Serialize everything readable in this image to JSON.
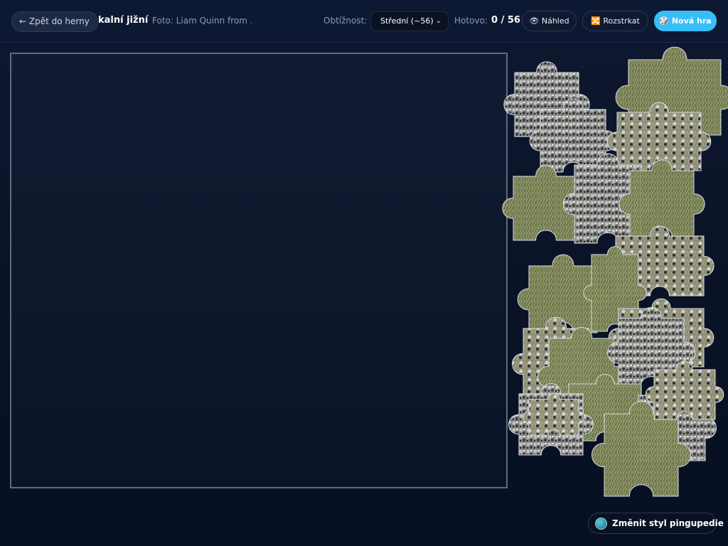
{
  "header": {
    "back_label": "← Zpět do herny",
    "title": "kalní jižní",
    "credit": "Foto: Liam Quinn from ...",
    "difficulty_label": "Obtížnost:",
    "difficulty_value": "Střední (~56)",
    "done_label": "Hotovo:",
    "done_value": "0 / 56",
    "preview_label": "👁 Náhled",
    "shuffle_label": "🔀 Rozstrkat",
    "new_game_label": "🎲 Nová hra"
  },
  "puzzle": {
    "placed": 0,
    "total": 56
  },
  "footer": {
    "style_label": "Změnit styl pingupedie"
  },
  "colors": {
    "accent": "#38bdf8",
    "background": "#0a1226",
    "grass": "#7d8a5a",
    "rock": "#8c8c8c"
  }
}
